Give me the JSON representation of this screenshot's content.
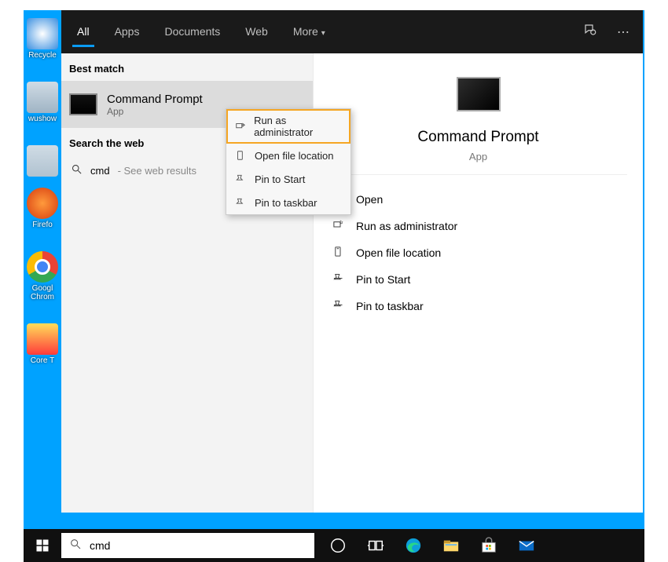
{
  "desktop_icons": [
    {
      "label": "Recycle"
    },
    {
      "label": "wushow"
    },
    {
      "label": ""
    },
    {
      "label": "Firefo"
    },
    {
      "label": "Googl\nChrom"
    },
    {
      "label": "Core T"
    }
  ],
  "tabs": {
    "all": "All",
    "apps": "Apps",
    "documents": "Documents",
    "web": "Web",
    "more": "More"
  },
  "sections": {
    "best_match": "Best match",
    "search_web": "Search the web"
  },
  "best_match": {
    "title": "Command Prompt",
    "sub": "App"
  },
  "web_search": {
    "term": "cmd",
    "hint": "- See web results"
  },
  "context_menu": [
    {
      "label": "Run as administrator",
      "icon": "shield"
    },
    {
      "label": "Open file location",
      "icon": "folder"
    },
    {
      "label": "Pin to Start",
      "icon": "pin"
    },
    {
      "label": "Pin to taskbar",
      "icon": "pin"
    }
  ],
  "preview": {
    "title": "Command Prompt",
    "sub": "App"
  },
  "actions": [
    {
      "label": "Open",
      "icon": "open"
    },
    {
      "label": "Run as administrator",
      "icon": "shield"
    },
    {
      "label": "Open file location",
      "icon": "folder"
    },
    {
      "label": "Pin to Start",
      "icon": "pin"
    },
    {
      "label": "Pin to taskbar",
      "icon": "pin"
    }
  ],
  "search_input": {
    "value": "cmd"
  }
}
